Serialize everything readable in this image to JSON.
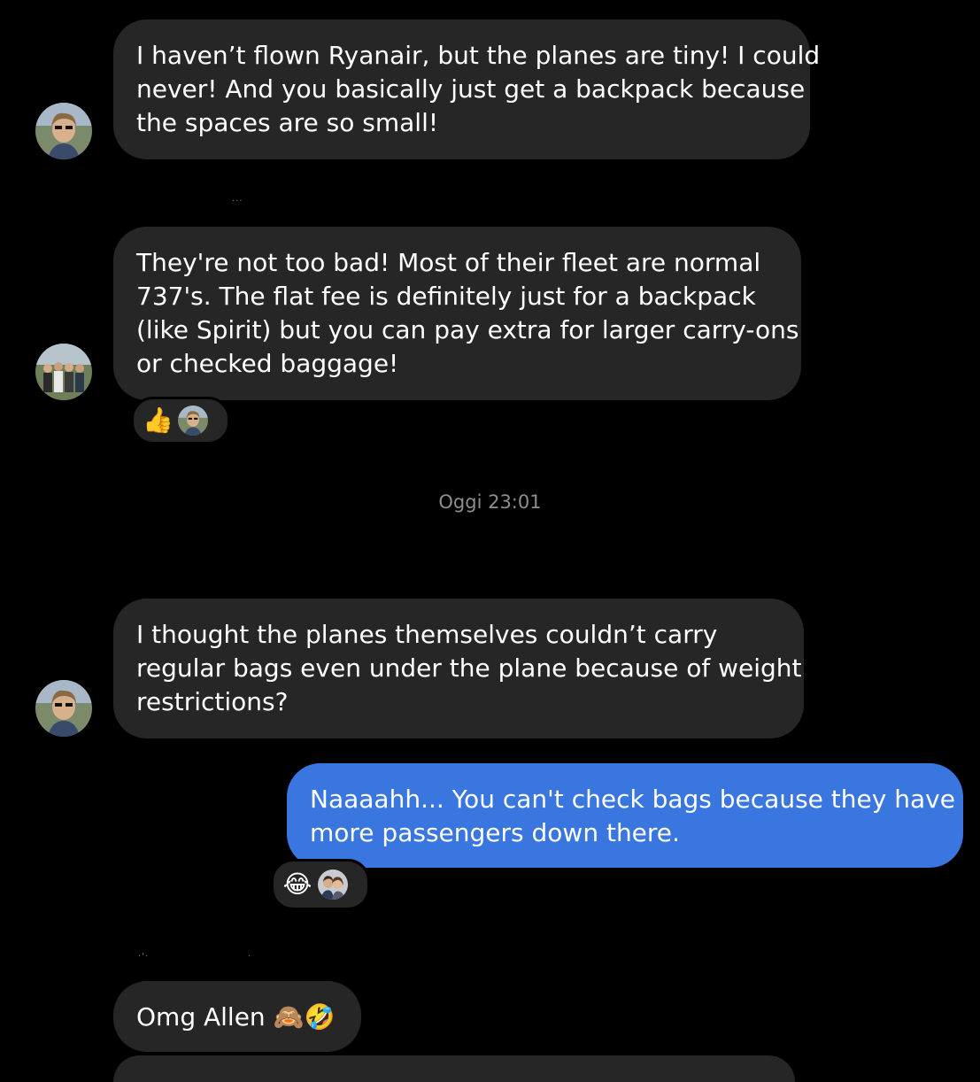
{
  "conversation": {
    "messages": [
      {
        "id": "msg1",
        "direction": "incoming",
        "lines": [
          "I haven’t flown Ryanair, but the planes are tiny! I could",
          "never! And you basically just get a backpack because",
          "the spaces are so small!"
        ]
      },
      {
        "id": "msg2",
        "direction": "incoming",
        "lines": [
          "They're not too bad! Most of their fleet are normal",
          "737's. The flat fee is definitely just for a backpack",
          "(like Spirit) but you can pay extra for larger carry-ons",
          "or checked baggage!"
        ],
        "reaction": {
          "emoji": "👍",
          "reactor_icon": "avatar-woman-icon"
        }
      },
      {
        "id": "msg3",
        "direction": "incoming",
        "lines": [
          "I thought the planes themselves couldn’t carry",
          "regular bags even under the plane because of weight",
          "restrictions?"
        ]
      },
      {
        "id": "msg4",
        "direction": "outgoing",
        "lines": [
          "Naaaahh... You can't check bags because they have",
          "more passengers down there."
        ],
        "reaction": {
          "emoji": "😂",
          "reactor_icon": "avatar-couple-icon"
        }
      },
      {
        "id": "msg5",
        "direction": "incoming",
        "lines": [
          "Omg Allen 🙈🤣"
        ]
      }
    ],
    "timestamp": "Oggi 23:01"
  },
  "colors": {
    "background": "#000000",
    "incoming_bubble": "#262626",
    "outgoing_bubble": "#3a76e0",
    "timestamp_text": "#8e8e8e"
  }
}
